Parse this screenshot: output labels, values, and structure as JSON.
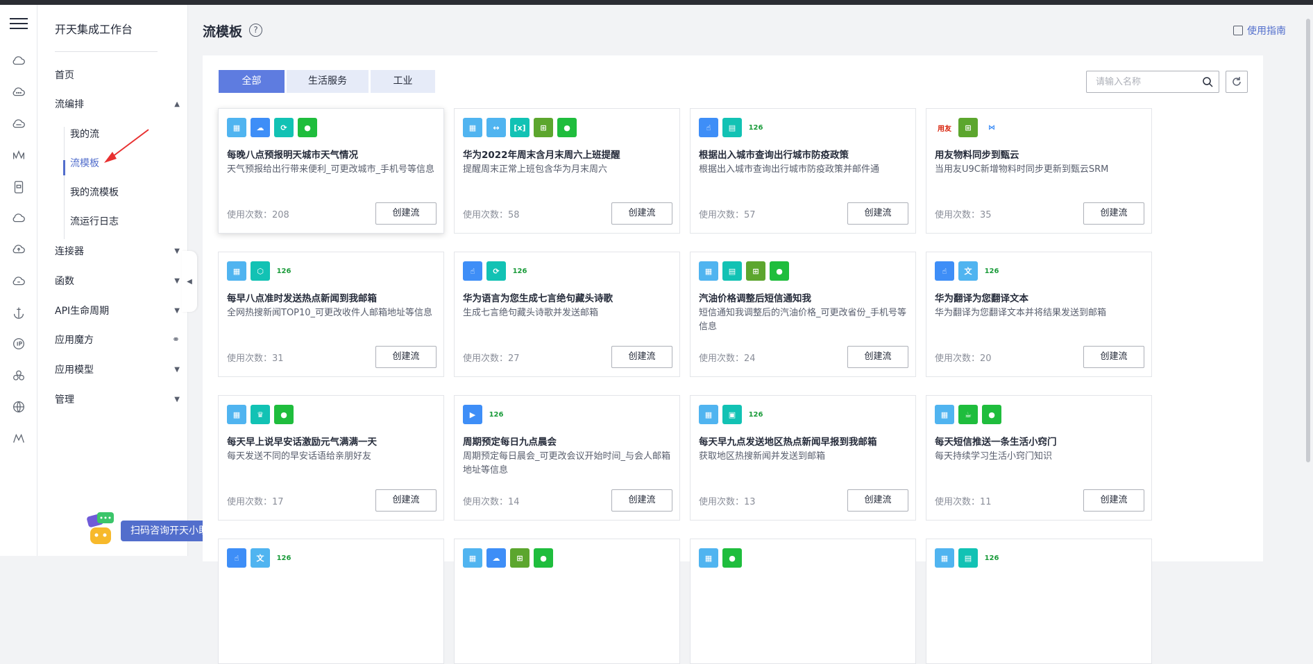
{
  "workspace": "开天集成工作台",
  "menu": {
    "home": "首页",
    "orchestration": "流编排",
    "sub": {
      "my_flows": "我的流",
      "templates": "流模板",
      "my_templates": "我的流模板",
      "logs": "流运行日志"
    },
    "connectors": "连接器",
    "functions": "函数",
    "api_lifecycle": "API生命周期",
    "app_magic": "应用魔方",
    "app_model": "应用模型",
    "manage": "管理"
  },
  "consult_label": "扫码咨询开天小助手",
  "page": {
    "title": "流模板",
    "guide": "使用指南",
    "search_placeholder": "请输入名称"
  },
  "tabs": [
    {
      "label": "全部",
      "active": true
    },
    {
      "label": "生活服务",
      "active": false
    },
    {
      "label": "工业",
      "active": false
    }
  ],
  "usage_prefix": "使用次数：",
  "create_label": "创建流",
  "cards": [
    {
      "title": "每晚八点预报明天城市天气情况",
      "desc": "天气预报给出行带来便利_可更改城市_手机号等信息",
      "uses": "208",
      "icons": [
        "calendar",
        "cloud",
        "refresh-circle",
        "chat"
      ]
    },
    {
      "title": "华为2022年周末含月末周六上班提醒",
      "desc": "提醒周末正常上班包含华为月末周六",
      "uses": "58",
      "icons": [
        "calendar",
        "calendar-range",
        "brackets",
        "flow",
        "chat"
      ]
    },
    {
      "title": "根据出入城市查询出行城市防疫政策",
      "desc": "根据出入城市查询出行城市防疫政策并邮件通",
      "uses": "57",
      "icons": [
        "touch",
        "document",
        "mail-126"
      ]
    },
    {
      "title": "用友物料同步到甄云",
      "desc": "当用友U9C新增物料时同步更新到甄云SRM",
      "uses": "35",
      "icons": [
        "yonyou",
        "flow",
        "zhenyun"
      ]
    },
    {
      "title": "每早八点准时发送热点新闻到我邮箱",
      "desc": "全网热搜新闻TOP10_可更改收件人邮箱地址等信息",
      "uses": "31",
      "icons": [
        "calendar",
        "hexagon",
        "mail-126"
      ]
    },
    {
      "title": "华为语言为您生成七言绝句藏头诗歌",
      "desc": "生成七言绝句藏头诗歌并发送邮箱",
      "uses": "27",
      "icons": [
        "touch",
        "refresh-circle",
        "mail-126"
      ]
    },
    {
      "title": "汽油价格调整后短信通知我",
      "desc": "短信通知我调整后的汽油价格_可更改省份_手机号等信息",
      "uses": "24",
      "icons": [
        "calendar",
        "document",
        "flow",
        "chat"
      ]
    },
    {
      "title": "华为翻译为您翻译文本",
      "desc": "华为翻译为您翻译文本并将结果发送到邮箱",
      "uses": "20",
      "icons": [
        "touch",
        "translate",
        "mail-126"
      ]
    },
    {
      "title": "每天早上说早安话激励元气满满一天",
      "desc": "每天发送不同的早安话语给亲朋好友",
      "uses": "17",
      "icons": [
        "calendar",
        "crown",
        "chat"
      ]
    },
    {
      "title": "周期预定每日九点晨会",
      "desc": "周期预定每日晨会_可更改会议开始时间_与会人邮箱地址等信息",
      "uses": "14",
      "icons": [
        "video",
        "mail-126"
      ]
    },
    {
      "title": "每天早九点发送地区热点新闻早报到我邮箱",
      "desc": "获取地区热搜新闻并发送到邮箱",
      "uses": "13",
      "icons": [
        "calendar",
        "news",
        "mail-126"
      ]
    },
    {
      "title": "每天短信推送一条生活小窍门",
      "desc": "每天持续学习生活小窍门知识",
      "uses": "11",
      "icons": [
        "calendar",
        "cup",
        "chat"
      ]
    },
    {
      "title": "",
      "desc": "",
      "uses": "",
      "icons": [
        "touch",
        "translate",
        "mail-126"
      ]
    },
    {
      "title": "",
      "desc": "",
      "uses": "",
      "icons": [
        "calendar",
        "cloud",
        "flow",
        "chat"
      ]
    },
    {
      "title": "",
      "desc": "",
      "uses": "",
      "icons": [
        "calendar",
        "chat"
      ]
    },
    {
      "title": "",
      "desc": "",
      "uses": "",
      "icons": [
        "calendar",
        "document",
        "mail-126"
      ]
    }
  ],
  "colors": {
    "primary": "#5e7ce0",
    "link": "#526ecc",
    "tab_bg": "#e6ebf8",
    "icon_blue": "#3e8ef7",
    "icon_lightblue": "#50b4f0",
    "icon_teal": "#12c2b4",
    "icon_green": "#1fbd3d",
    "icon_olive": "#5ca62e"
  }
}
